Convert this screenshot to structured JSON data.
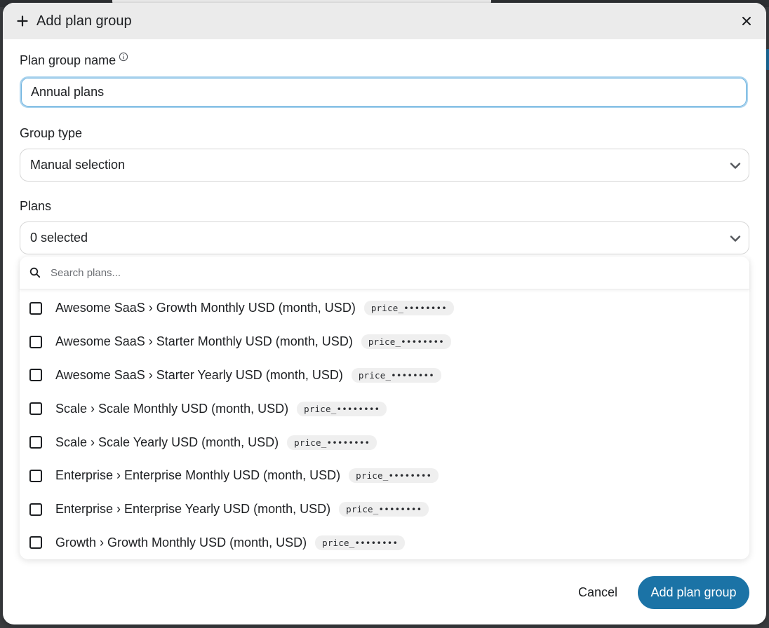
{
  "modal": {
    "title": "Add plan group",
    "close_icon": "close-icon"
  },
  "form": {
    "name_label": "Plan group name",
    "name_value": "Annual plans",
    "group_type_label": "Group type",
    "group_type_value": "Manual selection",
    "plans_label": "Plans",
    "plans_value": "0 selected"
  },
  "plans_dropdown": {
    "search_placeholder": "Search plans...",
    "items": [
      {
        "label": "Awesome SaaS › Growth Monthly USD (month, USD)",
        "price_id": "price_••••••••",
        "checked": false
      },
      {
        "label": "Awesome SaaS › Starter Monthly USD (month, USD)",
        "price_id": "price_••••••••",
        "checked": false
      },
      {
        "label": "Awesome SaaS › Starter Yearly USD (month, USD)",
        "price_id": "price_••••••••",
        "checked": false
      },
      {
        "label": "Scale › Scale Monthly USD (month, USD)",
        "price_id": "price_••••••••",
        "checked": false
      },
      {
        "label": "Scale › Scale Yearly USD (month, USD)",
        "price_id": "price_••••••••",
        "checked": false
      },
      {
        "label": "Enterprise › Enterprise Monthly USD (month, USD)",
        "price_id": "price_••••••••",
        "checked": false
      },
      {
        "label": "Enterprise › Enterprise Yearly USD (month, USD)",
        "price_id": "price_••••••••",
        "checked": false
      },
      {
        "label": "Growth › Growth Monthly USD (month, USD)",
        "price_id": "price_••••••••",
        "checked": false
      }
    ]
  },
  "footer": {
    "cancel_label": "Cancel",
    "submit_label": "Add plan group"
  },
  "colors": {
    "primary": "#1b73a6",
    "header_bg": "#ebebeb",
    "focus_ring": "#a9d3ee"
  }
}
